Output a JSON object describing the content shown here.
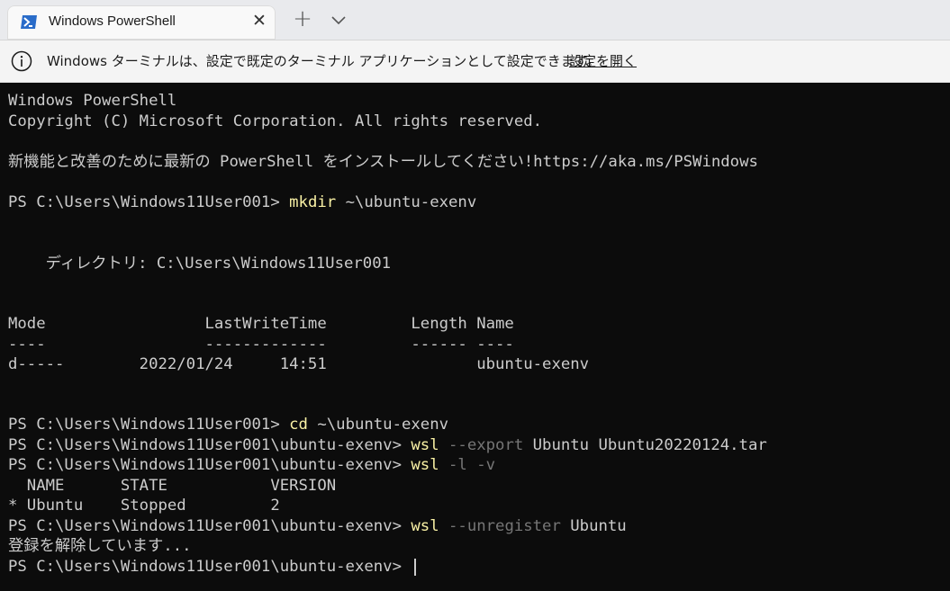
{
  "tab": {
    "title": "Windows PowerShell",
    "close_label": "✕"
  },
  "titlebar": {
    "new_tab_label": "+"
  },
  "infobar": {
    "message": "Windows ターミナルは、設定で既定のターミナル アプリケーションとして設定できます。",
    "link_label": "設定を開く"
  },
  "terminal": {
    "header1": "Windows PowerShell",
    "header2": "Copyright (C) Microsoft Corporation. All rights reserved.",
    "notice": "新機能と改善のために最新の PowerShell をインストールしてください!https://aka.ms/PSWindows",
    "prompt_home": "PS C:\\Users\\Windows11User001> ",
    "prompt_env": "PS C:\\Users\\Windows11User001\\ubuntu-exenv> ",
    "cmd1": {
      "name": "mkdir",
      "arg": " ~\\ubuntu-exenv"
    },
    "directory_line": "    ディレクトリ: C:\\Users\\Windows11User001",
    "dir_header": "Mode                 LastWriteTime         Length Name",
    "dir_separator": "----                 -------------         ------ ----",
    "dir_row": "d-----        2022/01/24     14:51                ubuntu-exenv",
    "cmd2": {
      "name": "cd",
      "arg": " ~\\ubuntu-exenv"
    },
    "cmd3": {
      "name": "wsl",
      "param": " --export",
      "arg": " Ubuntu Ubuntu20220124.tar"
    },
    "cmd4": {
      "name": "wsl",
      "param": " -l -v"
    },
    "wsl_header": "  NAME      STATE           VERSION",
    "wsl_row": "* Ubuntu    Stopped         2",
    "cmd5": {
      "name": "wsl",
      "param": " --unregister",
      "arg": " Ubuntu"
    },
    "unregister_output": "登録を解除しています..."
  }
}
